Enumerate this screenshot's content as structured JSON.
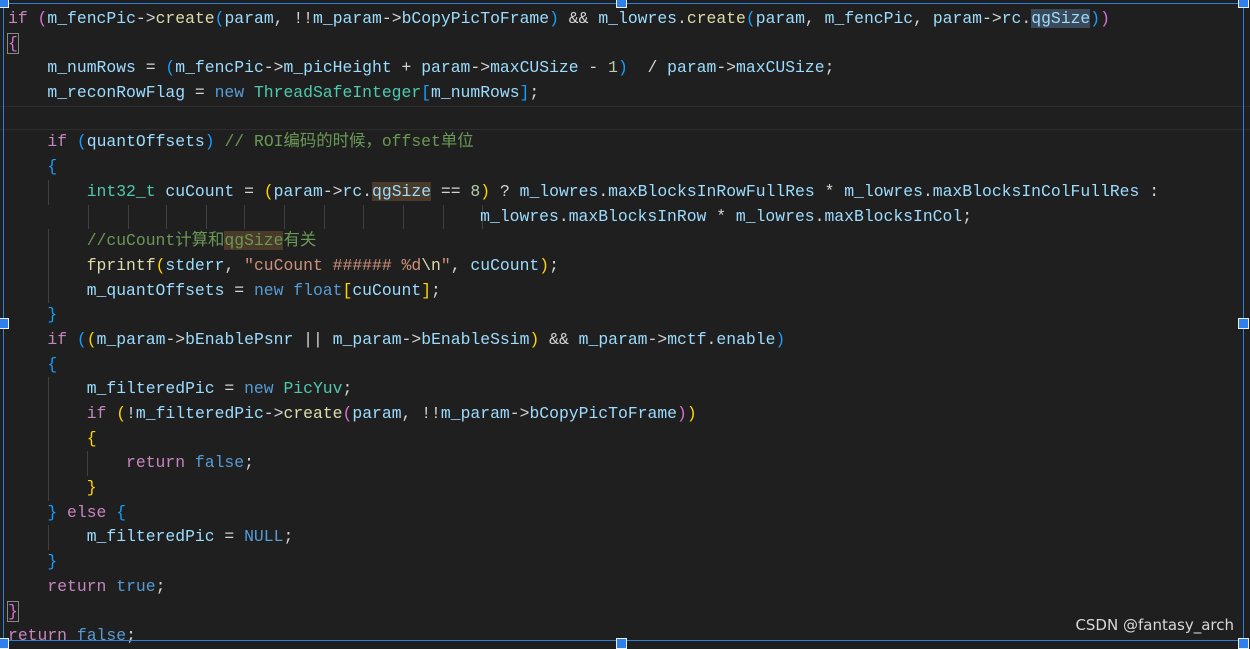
{
  "colors": {
    "background": "#1f1f1f",
    "selection_border": "#2f7fd6",
    "keyword": "#569cd6",
    "control_keyword": "#c586c0",
    "function": "#dcdcaa",
    "type": "#4ec9b0",
    "variable": "#9cdcfe",
    "string": "#ce9178",
    "number": "#b5cea8",
    "comment": "#6a9955",
    "bracket_level1": "#da70d6",
    "bracket_level2": "#179fff",
    "bracket_level3": "#ffd700"
  },
  "code_lines": [
    [
      [
        "kwc",
        "if"
      ],
      [
        "op",
        " "
      ],
      [
        "p1",
        "("
      ],
      [
        "vr",
        "m_fencPic"
      ],
      [
        "op",
        "->"
      ],
      [
        "fn",
        "create"
      ],
      [
        "p2",
        "("
      ],
      [
        "vr",
        "param"
      ],
      [
        "op",
        ", !!"
      ],
      [
        "vr",
        "m_param"
      ],
      [
        "op",
        "->"
      ],
      [
        "vr",
        "bCopyPicToFrame"
      ],
      [
        "p2",
        ")"
      ],
      [
        "op",
        " && "
      ],
      [
        "vr",
        "m_lowres"
      ],
      [
        "op",
        "."
      ],
      [
        "fn",
        "create"
      ],
      [
        "p2",
        "("
      ],
      [
        "vr",
        "param"
      ],
      [
        "op",
        ", "
      ],
      [
        "vr",
        "m_fencPic"
      ],
      [
        "op",
        ", "
      ],
      [
        "vr",
        "param"
      ],
      [
        "op",
        "->"
      ],
      [
        "vr",
        "rc"
      ],
      [
        "op",
        "."
      ],
      [
        "vr hl-sel",
        "qgSize"
      ],
      [
        "p2",
        ")"
      ],
      [
        "p1",
        ")"
      ]
    ],
    [
      [
        "p1 brk-box",
        "{"
      ]
    ],
    [
      [
        "op",
        "    "
      ],
      [
        "vr",
        "m_numRows"
      ],
      [
        "op",
        " = "
      ],
      [
        "p2",
        "("
      ],
      [
        "vr",
        "m_fencPic"
      ],
      [
        "op",
        "->"
      ],
      [
        "vr",
        "m_picHeight"
      ],
      [
        "op",
        " + "
      ],
      [
        "vr",
        "param"
      ],
      [
        "op",
        "->"
      ],
      [
        "vr",
        "maxCUSize"
      ],
      [
        "op",
        " - "
      ],
      [
        "nm",
        "1"
      ],
      [
        "p2",
        ")"
      ],
      [
        "op",
        "  / "
      ],
      [
        "vr",
        "param"
      ],
      [
        "op",
        "->"
      ],
      [
        "vr",
        "maxCUSize"
      ],
      [
        "op",
        ";"
      ]
    ],
    [
      [
        "op",
        "    "
      ],
      [
        "vr",
        "m_reconRowFlag"
      ],
      [
        "op",
        " = "
      ],
      [
        "kw",
        "new"
      ],
      [
        "op",
        " "
      ],
      [
        "ty",
        "ThreadSafeInteger"
      ],
      [
        "p2",
        "["
      ],
      [
        "vr",
        "m_numRows"
      ],
      [
        "p2",
        "]"
      ],
      [
        "op",
        ";"
      ]
    ],
    [],
    [
      [
        "op",
        "    "
      ],
      [
        "kwc",
        "if"
      ],
      [
        "op",
        " "
      ],
      [
        "p2",
        "("
      ],
      [
        "vr",
        "quantOffsets"
      ],
      [
        "p2",
        ")"
      ],
      [
        "op",
        " "
      ],
      [
        "cm",
        "// ROI编码的时候，offset单位"
      ]
    ],
    [
      [
        "op",
        "    "
      ],
      [
        "p2",
        "{"
      ]
    ],
    [
      [
        "op",
        "        "
      ],
      [
        "ty",
        "int32_t"
      ],
      [
        "op",
        " "
      ],
      [
        "vr",
        "cuCount"
      ],
      [
        "op",
        " = "
      ],
      [
        "p3",
        "("
      ],
      [
        "vr",
        "param"
      ],
      [
        "op",
        "->"
      ],
      [
        "vr",
        "rc"
      ],
      [
        "op",
        "."
      ],
      [
        "vr hl",
        "qgSize"
      ],
      [
        "op",
        " == "
      ],
      [
        "nm",
        "8"
      ],
      [
        "p3",
        ")"
      ],
      [
        "op",
        " ? "
      ],
      [
        "vr",
        "m_lowres"
      ],
      [
        "op",
        "."
      ],
      [
        "vr",
        "maxBlocksInRowFullRes"
      ],
      [
        "op",
        " * "
      ],
      [
        "vr",
        "m_lowres"
      ],
      [
        "op",
        "."
      ],
      [
        "vr",
        "maxBlocksInColFullRes"
      ],
      [
        "op",
        " :"
      ]
    ],
    [
      [
        "op",
        "                                                "
      ],
      [
        "vr",
        "m_lowres"
      ],
      [
        "op",
        "."
      ],
      [
        "vr",
        "maxBlocksInRow"
      ],
      [
        "op",
        " * "
      ],
      [
        "vr",
        "m_lowres"
      ],
      [
        "op",
        "."
      ],
      [
        "vr",
        "maxBlocksInCol"
      ],
      [
        "op",
        ";"
      ]
    ],
    [
      [
        "op",
        "        "
      ],
      [
        "cm",
        "//cuCount计算和"
      ],
      [
        "cm hl",
        "qgSize"
      ],
      [
        "cm",
        "有关"
      ]
    ],
    [
      [
        "op",
        "        "
      ],
      [
        "fn",
        "fprintf"
      ],
      [
        "p3",
        "("
      ],
      [
        "vr",
        "stderr"
      ],
      [
        "op",
        ", "
      ],
      [
        "st",
        "\"cuCount ###### %d"
      ],
      [
        "fn",
        "\\n"
      ],
      [
        "st",
        "\""
      ],
      [
        "op",
        ", "
      ],
      [
        "vr",
        "cuCount"
      ],
      [
        "p3",
        ")"
      ],
      [
        "op",
        ";"
      ]
    ],
    [
      [
        "op",
        "        "
      ],
      [
        "vr",
        "m_quantOffsets"
      ],
      [
        "op",
        " = "
      ],
      [
        "kw",
        "new"
      ],
      [
        "op",
        " "
      ],
      [
        "kw",
        "float"
      ],
      [
        "p3",
        "["
      ],
      [
        "vr",
        "cuCount"
      ],
      [
        "p3",
        "]"
      ],
      [
        "op",
        ";"
      ]
    ],
    [
      [
        "op",
        "    "
      ],
      [
        "p2",
        "}"
      ]
    ],
    [
      [
        "op",
        "    "
      ],
      [
        "kwc",
        "if"
      ],
      [
        "op",
        " "
      ],
      [
        "p2",
        "("
      ],
      [
        "p3",
        "("
      ],
      [
        "vr",
        "m_param"
      ],
      [
        "op",
        "->"
      ],
      [
        "vr",
        "bEnablePsnr"
      ],
      [
        "op",
        " || "
      ],
      [
        "vr",
        "m_param"
      ],
      [
        "op",
        "->"
      ],
      [
        "vr",
        "bEnableSsim"
      ],
      [
        "p3",
        ")"
      ],
      [
        "op",
        " && "
      ],
      [
        "vr",
        "m_param"
      ],
      [
        "op",
        "->"
      ],
      [
        "vr",
        "mctf"
      ],
      [
        "op",
        "."
      ],
      [
        "vr",
        "enable"
      ],
      [
        "p2",
        ")"
      ]
    ],
    [
      [
        "op",
        "    "
      ],
      [
        "p2",
        "{"
      ]
    ],
    [
      [
        "op",
        "        "
      ],
      [
        "vr",
        "m_filteredPic"
      ],
      [
        "op",
        " = "
      ],
      [
        "kw",
        "new"
      ],
      [
        "op",
        " "
      ],
      [
        "ty",
        "PicYuv"
      ],
      [
        "op",
        ";"
      ]
    ],
    [
      [
        "op",
        "        "
      ],
      [
        "kwc",
        "if"
      ],
      [
        "op",
        " "
      ],
      [
        "p3",
        "("
      ],
      [
        "op",
        "!"
      ],
      [
        "vr",
        "m_filteredPic"
      ],
      [
        "op",
        "->"
      ],
      [
        "fn",
        "create"
      ],
      [
        "p1",
        "("
      ],
      [
        "vr",
        "param"
      ],
      [
        "op",
        ", !!"
      ],
      [
        "vr",
        "m_param"
      ],
      [
        "op",
        "->"
      ],
      [
        "vr",
        "bCopyPicToFrame"
      ],
      [
        "p1",
        ")"
      ],
      [
        "p3",
        ")"
      ]
    ],
    [
      [
        "op",
        "        "
      ],
      [
        "p3",
        "{"
      ]
    ],
    [
      [
        "op",
        "            "
      ],
      [
        "kwc",
        "return"
      ],
      [
        "op",
        " "
      ],
      [
        "kw",
        "false"
      ],
      [
        "op",
        ";"
      ]
    ],
    [
      [
        "op",
        "        "
      ],
      [
        "p3",
        "}"
      ]
    ],
    [
      [
        "op",
        "    "
      ],
      [
        "p2",
        "}"
      ],
      [
        "op",
        " "
      ],
      [
        "kwc",
        "else"
      ],
      [
        "op",
        " "
      ],
      [
        "p2",
        "{"
      ]
    ],
    [
      [
        "op",
        "        "
      ],
      [
        "vr",
        "m_filteredPic"
      ],
      [
        "op",
        " = "
      ],
      [
        "kw",
        "NULL"
      ],
      [
        "op",
        ";"
      ]
    ],
    [
      [
        "op",
        "    "
      ],
      [
        "p2",
        "}"
      ]
    ],
    [
      [
        "op",
        "    "
      ],
      [
        "kwc",
        "return"
      ],
      [
        "op",
        " "
      ],
      [
        "kw",
        "true"
      ],
      [
        "op",
        ";"
      ]
    ],
    [
      [
        "p1 brk-box",
        "}"
      ]
    ],
    [
      [
        "kwc",
        "return"
      ],
      [
        "op",
        " "
      ],
      [
        "kw",
        "false"
      ],
      [
        "op",
        ";"
      ]
    ]
  ],
  "watermark": "CSDN @fantasy_arch"
}
